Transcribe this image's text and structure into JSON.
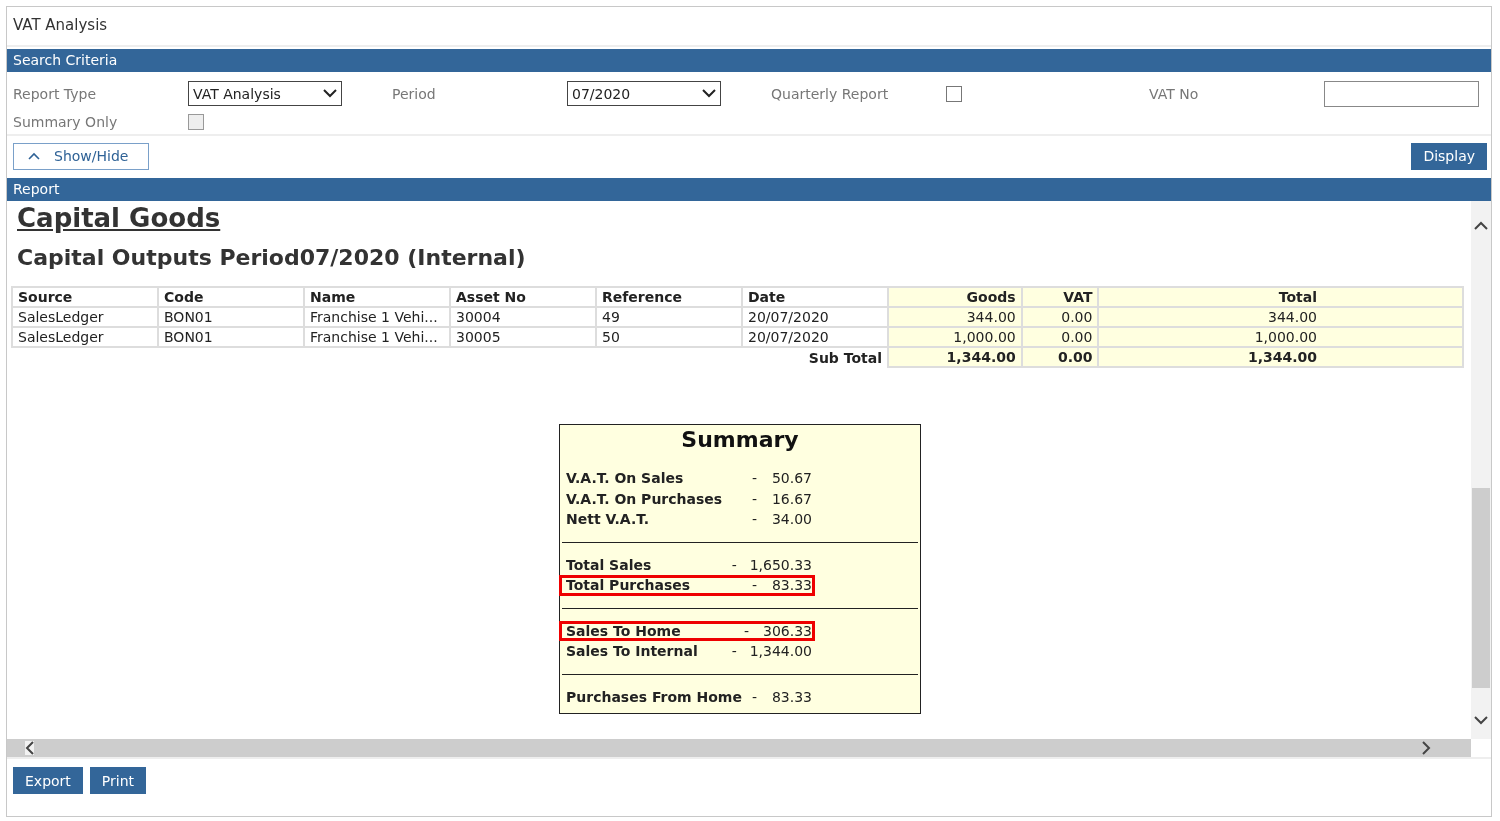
{
  "window": {
    "title": "VAT Analysis"
  },
  "search_criteria": {
    "heading": "Search Criteria",
    "report_type": {
      "label": "Report Type",
      "value": "VAT Analysis"
    },
    "period": {
      "label": "Period",
      "value": "07/2020"
    },
    "quarterly_report": {
      "label": "Quarterly Report",
      "checked": false,
      "disabled": false
    },
    "vat_no": {
      "label": "VAT No"
    },
    "summary_only": {
      "label": "Summary Only",
      "checked": false,
      "disabled": true
    }
  },
  "show_hide_button": "Show/Hide",
  "display_button": "Display",
  "report": {
    "heading": "Report",
    "section_title": "Capital Goods",
    "subtitle": "Capital Outputs Period07/2020 (Internal)",
    "table": {
      "columns": [
        "Source",
        "Code",
        "Name",
        "Asset No",
        "Reference",
        "Date",
        "Goods",
        "VAT",
        "Total"
      ],
      "rows": [
        [
          "SalesLedger",
          "BON01",
          "Franchise 1 Vehi...",
          "30004",
          "49",
          "20/07/2020",
          "344.00",
          "0.00",
          "344.00"
        ],
        [
          "SalesLedger",
          "BON01",
          "Franchise 1 Vehi...",
          "30005",
          "50",
          "20/07/2020",
          "1,000.00",
          "0.00",
          "1,000.00"
        ]
      ],
      "subtotal": {
        "label": "Sub Total",
        "values": [
          "1,344.00",
          "0.00",
          "1,344.00"
        ]
      }
    },
    "summary": {
      "title": "Summary",
      "groups": [
        [
          {
            "label": "V.A.T. On Sales",
            "separator": "-",
            "value": "50.67",
            "highlighted": false
          },
          {
            "label": "V.A.T. On Purchases",
            "separator": "-",
            "value": "16.67",
            "highlighted": false
          },
          {
            "label": "Nett V.A.T.",
            "separator": "-",
            "value": "34.00",
            "highlighted": false
          }
        ],
        [
          {
            "label": "Total Sales",
            "separator": "-",
            "value": "1,650.33",
            "highlighted": false
          },
          {
            "label": "Total Purchases",
            "separator": "-",
            "value": "83.33",
            "highlighted": true
          }
        ],
        [
          {
            "label": "Sales To Home",
            "separator": "-",
            "value": "306.33",
            "highlighted": true
          },
          {
            "label": "Sales To Internal",
            "separator": "-",
            "value": "1,344.00",
            "highlighted": false
          }
        ],
        [
          {
            "label": "Purchases From Home",
            "separator": "-",
            "value": "83.33",
            "highlighted": false
          }
        ]
      ]
    }
  },
  "footer_buttons": [
    "Export",
    "Print"
  ]
}
